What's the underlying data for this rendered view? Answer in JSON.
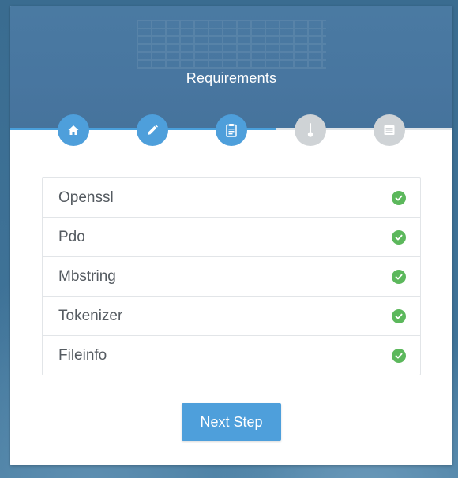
{
  "header": {
    "title": "Requirements"
  },
  "steps": [
    {
      "icon": "home-icon",
      "state": "active"
    },
    {
      "icon": "pencil-icon",
      "state": "active"
    },
    {
      "icon": "clipboard-icon",
      "state": "active"
    },
    {
      "icon": "thermometer-icon",
      "state": "inactive"
    },
    {
      "icon": "list-icon",
      "state": "inactive"
    }
  ],
  "progress": {
    "completed_fraction": 0.6
  },
  "requirements": [
    {
      "name": "Openssl",
      "status": "ok"
    },
    {
      "name": "Pdo",
      "status": "ok"
    },
    {
      "name": "Mbstring",
      "status": "ok"
    },
    {
      "name": "Tokenizer",
      "status": "ok"
    },
    {
      "name": "Fileinfo",
      "status": "ok"
    }
  ],
  "actions": {
    "next_label": "Next Step"
  },
  "colors": {
    "accent": "#4e9fdb",
    "header": "#4876a0",
    "success": "#5cb85c",
    "inactive": "#cfd3d6"
  }
}
